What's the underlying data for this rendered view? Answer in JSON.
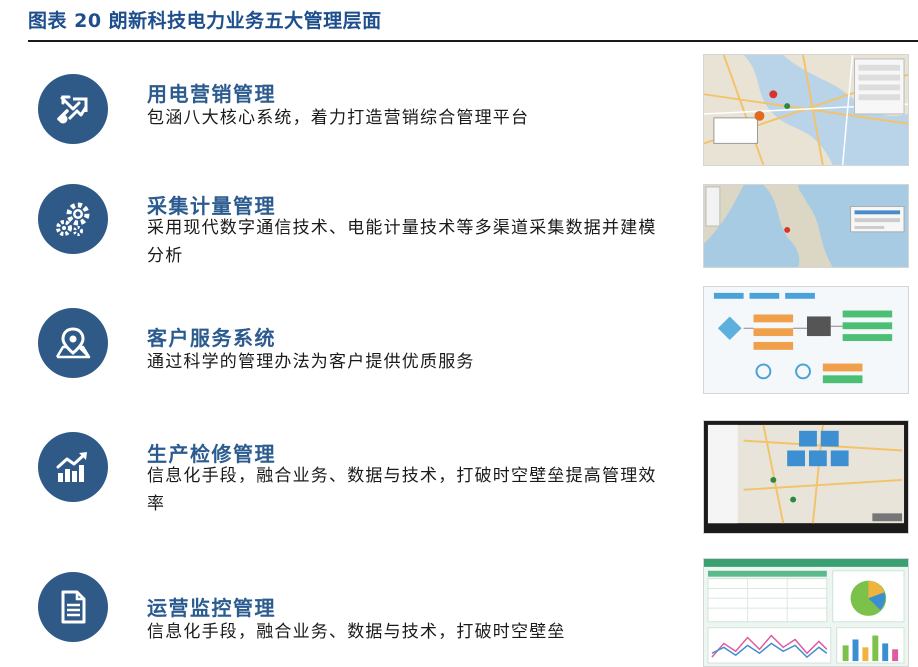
{
  "header": {
    "title": "图表 20 朗新科技电力业务五大管理层面"
  },
  "sections": [
    {
      "title": "用电营销管理",
      "desc": "包涵八大核心系统，着力打造营销综合管理平台",
      "icon": "share-arrows-icon"
    },
    {
      "title": "采集计量管理",
      "desc": "采用现代数字通信技术、电能计量技术等多渠道采集数据并建模分析",
      "icon": "gears-icon"
    },
    {
      "title": "客户服务系统",
      "desc": "通过科学的管理办法为客户提供优质服务",
      "icon": "map-pin-icon"
    },
    {
      "title": "生产检修管理",
      "desc": "信息化手段，融合业务、数据与技术，打破时空壁垒提高管理效率",
      "icon": "bar-chart-trend-icon"
    },
    {
      "title": "运营监控管理",
      "desc": "信息化手段，融合业务、数据与技术，打破时空壁垒",
      "icon": "document-icon"
    }
  ],
  "colors": {
    "accent": "#2f5a88",
    "title_text": "#2b5b8f",
    "heading": "#1f4e8c"
  }
}
